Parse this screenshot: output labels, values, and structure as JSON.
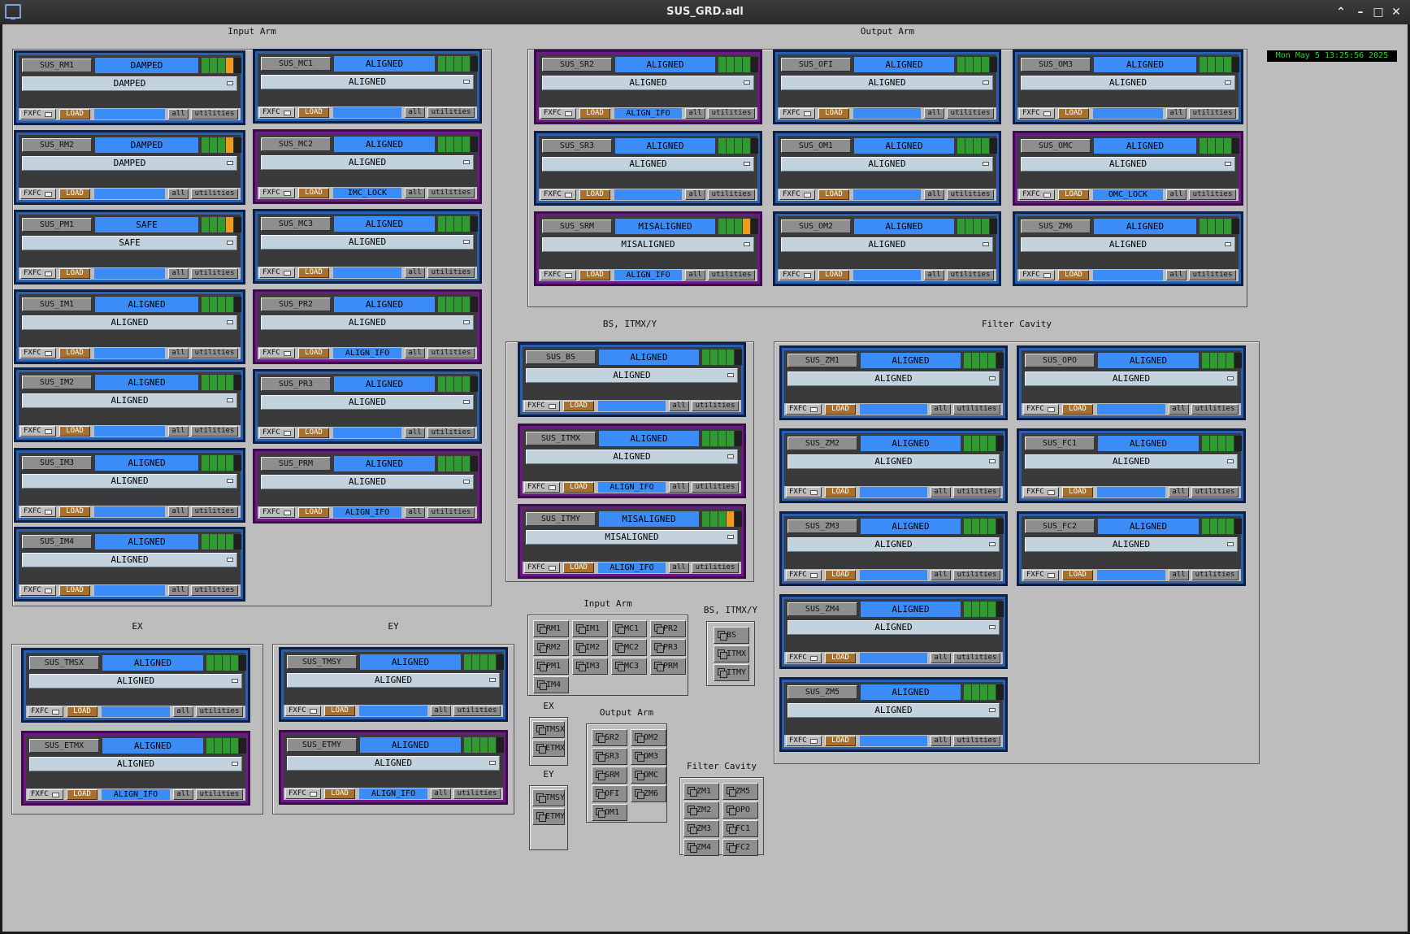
{
  "window": {
    "title": "SUS_GRD.adl"
  },
  "clock": "Mon May  5 13:25:56 2025",
  "sections": {
    "input_arm": "Input Arm",
    "output_arm": "Output Arm",
    "bs": "BS, ITMX/Y",
    "filter_cavity": "Filter Cavity",
    "ex": "EX",
    "ey": "EY"
  },
  "buttons": {
    "fxfc": "FXFC",
    "load": "LOAD",
    "all": "all",
    "utilities": "utilities"
  },
  "colors": {
    "indicator_green": "#2f9a2f",
    "indicator_orange": "#ef9a1c",
    "indicator_dark": "#1f1f1f",
    "state_blue": "#3b8cf7",
    "panel_blue": "#2a5fae",
    "panel_purple": "#6b1a86",
    "load_brown": "#a8702c"
  },
  "panels": [
    {
      "name": "SUS_RM1",
      "state": "DAMPED",
      "request": "DAMPED",
      "msg": "",
      "purple": false,
      "ind": [
        "g",
        "g",
        "g",
        "o",
        "d"
      ]
    },
    {
      "name": "SUS_RM2",
      "state": "DAMPED",
      "request": "DAMPED",
      "msg": "",
      "purple": false,
      "ind": [
        "g",
        "g",
        "g",
        "o",
        "d"
      ]
    },
    {
      "name": "SUS_PM1",
      "state": "SAFE",
      "request": "SAFE",
      "msg": "",
      "purple": false,
      "ind": [
        "g",
        "g",
        "g",
        "o",
        "d"
      ]
    },
    {
      "name": "SUS_IM1",
      "state": "ALIGNED",
      "request": "ALIGNED",
      "msg": "",
      "purple": false,
      "ind": [
        "g",
        "g",
        "g",
        "g",
        "d"
      ]
    },
    {
      "name": "SUS_IM2",
      "state": "ALIGNED",
      "request": "ALIGNED",
      "msg": "",
      "purple": false,
      "ind": [
        "g",
        "g",
        "g",
        "g",
        "d"
      ]
    },
    {
      "name": "SUS_IM3",
      "state": "ALIGNED",
      "request": "ALIGNED",
      "msg": "",
      "purple": false,
      "ind": [
        "g",
        "g",
        "g",
        "g",
        "d"
      ]
    },
    {
      "name": "SUS_IM4",
      "state": "ALIGNED",
      "request": "ALIGNED",
      "msg": "",
      "purple": false,
      "ind": [
        "g",
        "g",
        "g",
        "g",
        "d"
      ]
    },
    {
      "name": "SUS_MC1",
      "state": "ALIGNED",
      "request": "ALIGNED",
      "msg": "",
      "purple": false,
      "ind": [
        "g",
        "g",
        "g",
        "g",
        "d"
      ]
    },
    {
      "name": "SUS_MC2",
      "state": "ALIGNED",
      "request": "ALIGNED",
      "msg": "IMC_LOCK",
      "purple": true,
      "ind": [
        "g",
        "g",
        "g",
        "g",
        "d"
      ]
    },
    {
      "name": "SUS_MC3",
      "state": "ALIGNED",
      "request": "ALIGNED",
      "msg": "",
      "purple": false,
      "ind": [
        "g",
        "g",
        "g",
        "g",
        "d"
      ]
    },
    {
      "name": "SUS_PR2",
      "state": "ALIGNED",
      "request": "ALIGNED",
      "msg": "ALIGN_IFO",
      "purple": true,
      "ind": [
        "g",
        "g",
        "g",
        "g",
        "d"
      ]
    },
    {
      "name": "SUS_PR3",
      "state": "ALIGNED",
      "request": "ALIGNED",
      "msg": "",
      "purple": false,
      "ind": [
        "g",
        "g",
        "g",
        "g",
        "d"
      ]
    },
    {
      "name": "SUS_PRM",
      "state": "ALIGNED",
      "request": "ALIGNED",
      "msg": "ALIGN_IFO",
      "purple": true,
      "ind": [
        "g",
        "g",
        "g",
        "g",
        "d"
      ]
    },
    {
      "name": "SUS_SR2",
      "state": "ALIGNED",
      "request": "ALIGNED",
      "msg": "ALIGN_IFO",
      "purple": true,
      "ind": [
        "g",
        "g",
        "g",
        "g",
        "d"
      ]
    },
    {
      "name": "SUS_SR3",
      "state": "ALIGNED",
      "request": "ALIGNED",
      "msg": "",
      "purple": false,
      "ind": [
        "g",
        "g",
        "g",
        "g",
        "d"
      ]
    },
    {
      "name": "SUS_SRM",
      "state": "MISALIGNED",
      "request": "MISALIGNED",
      "msg": "ALIGN_IFO",
      "purple": true,
      "ind": [
        "g",
        "g",
        "g",
        "o",
        "d"
      ]
    },
    {
      "name": "SUS_OFI",
      "state": "ALIGNED",
      "request": "ALIGNED",
      "msg": "",
      "purple": false,
      "ind": [
        "g",
        "g",
        "g",
        "g",
        "d"
      ]
    },
    {
      "name": "SUS_OM1",
      "state": "ALIGNED",
      "request": "ALIGNED",
      "msg": "",
      "purple": false,
      "ind": [
        "g",
        "g",
        "g",
        "g",
        "d"
      ]
    },
    {
      "name": "SUS_OM2",
      "state": "ALIGNED",
      "request": "ALIGNED",
      "msg": "",
      "purple": false,
      "ind": [
        "g",
        "g",
        "g",
        "g",
        "d"
      ]
    },
    {
      "name": "SUS_OM3",
      "state": "ALIGNED",
      "request": "ALIGNED",
      "msg": "",
      "purple": false,
      "ind": [
        "g",
        "g",
        "g",
        "g",
        "d"
      ]
    },
    {
      "name": "SUS_OMC",
      "state": "ALIGNED",
      "request": "ALIGNED",
      "msg": "OMC_LOCK",
      "purple": true,
      "ind": [
        "g",
        "g",
        "g",
        "g",
        "d"
      ]
    },
    {
      "name": "SUS_ZM6",
      "state": "ALIGNED",
      "request": "ALIGNED",
      "msg": "",
      "purple": false,
      "ind": [
        "g",
        "g",
        "g",
        "g",
        "d"
      ]
    },
    {
      "name": "SUS_BS",
      "state": "ALIGNED",
      "request": "ALIGNED",
      "msg": "",
      "purple": false,
      "ind": [
        "g",
        "g",
        "g",
        "g",
        "d"
      ]
    },
    {
      "name": "SUS_ITMX",
      "state": "ALIGNED",
      "request": "ALIGNED",
      "msg": "ALIGN_IFO",
      "purple": true,
      "ind": [
        "g",
        "g",
        "g",
        "g",
        "d"
      ]
    },
    {
      "name": "SUS_ITMY",
      "state": "MISALIGNED",
      "request": "MISALIGNED",
      "msg": "ALIGN_IFO",
      "purple": true,
      "ind": [
        "g",
        "g",
        "g",
        "o",
        "d"
      ]
    },
    {
      "name": "SUS_ZM1",
      "state": "ALIGNED",
      "request": "ALIGNED",
      "msg": "",
      "purple": false,
      "ind": [
        "g",
        "g",
        "g",
        "g",
        "d"
      ]
    },
    {
      "name": "SUS_ZM2",
      "state": "ALIGNED",
      "request": "ALIGNED",
      "msg": "",
      "purple": false,
      "ind": [
        "g",
        "g",
        "g",
        "g",
        "d"
      ]
    },
    {
      "name": "SUS_ZM3",
      "state": "ALIGNED",
      "request": "ALIGNED",
      "msg": "",
      "purple": false,
      "ind": [
        "g",
        "g",
        "g",
        "g",
        "d"
      ]
    },
    {
      "name": "SUS_ZM4",
      "state": "ALIGNED",
      "request": "ALIGNED",
      "msg": "",
      "purple": false,
      "ind": [
        "g",
        "g",
        "g",
        "g",
        "d"
      ]
    },
    {
      "name": "SUS_ZM5",
      "state": "ALIGNED",
      "request": "ALIGNED",
      "msg": "",
      "purple": false,
      "ind": [
        "g",
        "g",
        "g",
        "g",
        "d"
      ]
    },
    {
      "name": "SUS_OPO",
      "state": "ALIGNED",
      "request": "ALIGNED",
      "msg": "",
      "purple": false,
      "ind": [
        "g",
        "g",
        "g",
        "g",
        "d"
      ]
    },
    {
      "name": "SUS_FC1",
      "state": "ALIGNED",
      "request": "ALIGNED",
      "msg": "",
      "purple": false,
      "ind": [
        "g",
        "g",
        "g",
        "g",
        "d"
      ]
    },
    {
      "name": "SUS_FC2",
      "state": "ALIGNED",
      "request": "ALIGNED",
      "msg": "",
      "purple": false,
      "ind": [
        "g",
        "g",
        "g",
        "g",
        "d"
      ]
    },
    {
      "name": "SUS_TMSX",
      "state": "ALIGNED",
      "request": "ALIGNED",
      "msg": "",
      "purple": false,
      "ind": [
        "g",
        "g",
        "g",
        "g",
        "d"
      ]
    },
    {
      "name": "SUS_ETMX",
      "state": "ALIGNED",
      "request": "ALIGNED",
      "msg": "ALIGN_IFO",
      "purple": true,
      "ind": [
        "g",
        "g",
        "g",
        "g",
        "d"
      ]
    },
    {
      "name": "SUS_TMSY",
      "state": "ALIGNED",
      "request": "ALIGNED",
      "msg": "",
      "purple": false,
      "ind": [
        "g",
        "g",
        "g",
        "g",
        "d"
      ]
    },
    {
      "name": "SUS_ETMY",
      "state": "ALIGNED",
      "request": "ALIGNED",
      "msg": "ALIGN_IFO",
      "purple": true,
      "ind": [
        "g",
        "g",
        "g",
        "g",
        "d"
      ]
    }
  ],
  "shortcuts": {
    "input_arm": {
      "label": "Input Arm",
      "items": [
        "RM1",
        "IM1",
        "MC1",
        "PR2",
        "RM2",
        "IM2",
        "MC2",
        "PR3",
        "PM1",
        "IM3",
        "MC3",
        "PRM",
        "IM4"
      ]
    },
    "bs": {
      "label": "BS, ITMX/Y",
      "items": [
        "BS",
        "ITMX",
        "ITMY"
      ]
    },
    "ex": {
      "label": "EX",
      "items": [
        "TMSX",
        "ETMX"
      ]
    },
    "ey": {
      "label": "EY",
      "items": [
        "TMSY",
        "ETMY"
      ]
    },
    "output_arm": {
      "label": "Output Arm",
      "items": [
        "SR2",
        "OM2",
        "SR3",
        "OM3",
        "SRM",
        "OMC",
        "OFI",
        "ZM6",
        "OM1"
      ]
    },
    "filter_cavity": {
      "label": "Filter Cavity",
      "items": [
        "ZM1",
        "ZM5",
        "ZM2",
        "OPO",
        "ZM3",
        "FC1",
        "ZM4",
        "FC2"
      ]
    }
  }
}
